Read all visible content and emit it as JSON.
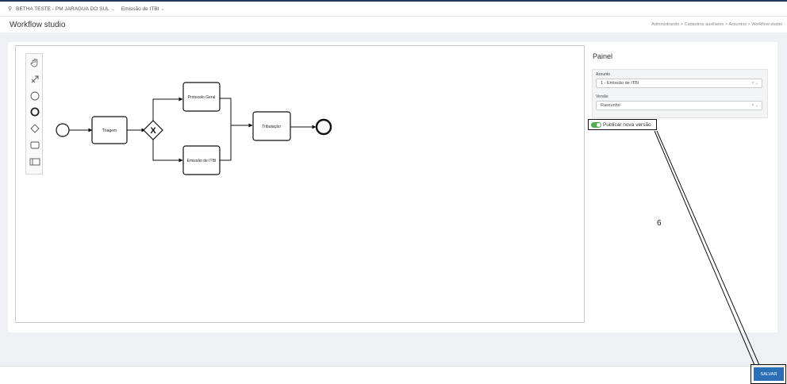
{
  "topbar": {
    "pin_icon": "pin-icon",
    "entity": "BETHA TESTE - PM JARAGUA DO SUL",
    "module": "Emissão de ITBI",
    "caret": "⌄"
  },
  "header": {
    "title": "Workflow studio",
    "breadcrumb": "Administrando > Cadastros auxiliares > Assuntos > Workflow studio"
  },
  "palette": {
    "tools": [
      "hand-tool-icon",
      "lasso-tool-icon",
      "start-event-icon",
      "end-event-icon",
      "gateway-icon",
      "task-icon",
      "pool-icon"
    ]
  },
  "diagram": {
    "tasks": {
      "triagem": "Triagem",
      "protocolo": "Protocolo Geral",
      "emissao": "Emissão de ITBI",
      "tributacao": "Tributação"
    },
    "gateway_symbol": "X"
  },
  "panel": {
    "title": "Painel",
    "assunto_label": "Assunto",
    "assunto_value": "1 - Emissão de ITBI",
    "versao_label": "Versão",
    "versao_value": "Rascunho",
    "select_controls": "× ⌄",
    "toggle_label": "Publicar nova versão",
    "toggle_on": true
  },
  "annotation": {
    "number": "6"
  },
  "footer": {
    "save_label": "SALVAR"
  },
  "colors": {
    "primary": "#2c6fb7",
    "toggle": "#4caf50",
    "top_border": "#1f3a5a"
  }
}
